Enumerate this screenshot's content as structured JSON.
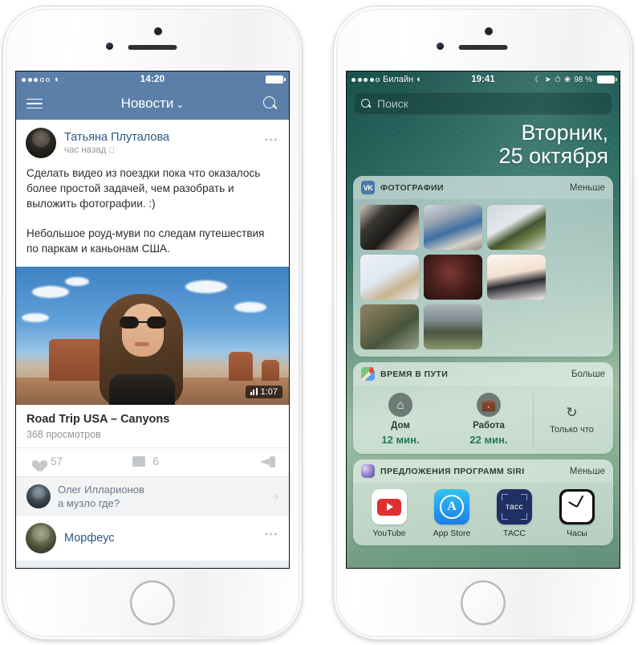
{
  "left_phone": {
    "status_bar": {
      "signal": "•••○○",
      "wifi_icon": "wifi-icon",
      "time": "14:20",
      "battery_icon": "battery-full-icon"
    },
    "navbar": {
      "menu_icon": "hamburger-icon",
      "title": "Новости",
      "chevron": "⌄",
      "search_icon": "search-icon"
    },
    "post": {
      "author": "Татьяна Плуталова",
      "timestamp": "час назад",
      "platform_icon": "",
      "more_icon": "•••",
      "text": "Сделать видео из поездки пока что оказалось более простой задачей, чем разобрать и выложить фотографии. :)\n\nНебольшое роуд-муви по следам путешествия по паркам и каньонам США.",
      "video": {
        "duration": "1:07",
        "title": "Road Trip USA – Canyons",
        "views": "368 просмотров"
      },
      "actions": {
        "like_icon": "heart-icon",
        "likes": "57",
        "comment_icon": "comment-icon",
        "comments": "6",
        "share_icon": "megaphone-icon"
      }
    },
    "comment": {
      "author": "Олег Илларионов",
      "text": "а музло где?",
      "chevron": "›"
    },
    "next_post": {
      "author": "Морфеус",
      "more_icon": "•••"
    }
  },
  "right_phone": {
    "status_bar": {
      "signal": "••••○",
      "carrier": "Билайн",
      "wifi_icon": "wifi-icon",
      "time": "19:41",
      "icons": [
        "do-not-disturb-icon",
        "location-icon",
        "alarm-icon",
        "bluetooth-icon"
      ],
      "battery_percent": "98 %",
      "battery_icon": "battery-full-icon"
    },
    "search": {
      "icon": "search-icon",
      "placeholder": "Поиск"
    },
    "date": {
      "line1": "Вторник,",
      "line2": "25 октября"
    },
    "widgets": [
      {
        "id": "photos",
        "icon": "vk-icon",
        "icon_label": "VK",
        "title": "ФОТОГРАФИИ",
        "action": "Меньше",
        "photos": [
          "phone-with-flowers",
          "man-in-mall",
          "woman-green-jacket",
          "illustration-girl-text",
          "dog-in-red-scarf",
          "anime-girl-portrait",
          "wooden-fence-forest",
          "horse-in-field"
        ]
      },
      {
        "id": "travel-time",
        "icon": "maps-icon",
        "title": "ВРЕМЯ В ПУТИ",
        "action": "Больше",
        "destinations": [
          {
            "icon": "home-icon",
            "glyph": "⌂",
            "label": "Дом",
            "value": "12 мин."
          },
          {
            "icon": "briefcase-icon",
            "glyph": "💼",
            "label": "Работа",
            "value": "22 мин."
          }
        ],
        "refresh": {
          "icon": "refresh-icon",
          "glyph": "↻",
          "label": "Только что"
        }
      },
      {
        "id": "siri-suggestions",
        "icon": "siri-icon",
        "title": "ПРЕДЛОЖЕНИЯ ПРОГРАММ SIRI",
        "action": "Меньше",
        "apps": [
          {
            "icon": "youtube-icon",
            "name": "YouTube"
          },
          {
            "icon": "app-store-icon",
            "name": "App Store",
            "glyph": "A"
          },
          {
            "icon": "tass-icon",
            "name": "ТАСС",
            "glyph": "тасс"
          },
          {
            "icon": "clock-icon",
            "name": "Часы"
          }
        ]
      }
    ]
  },
  "colors": {
    "vk_blue": "#5b7fa8",
    "vk_link": "#2a5885",
    "ios_green": "#1f7a52",
    "accent_red": "#e02f2f"
  }
}
